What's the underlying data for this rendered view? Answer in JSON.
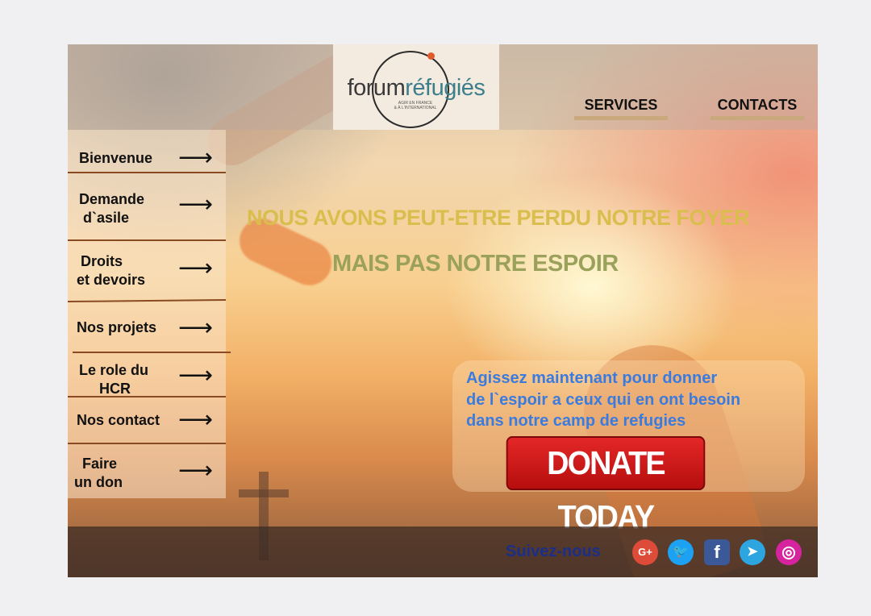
{
  "logo": {
    "part1": "forum",
    "part2": "réfugiés",
    "tagline_1": "AGIR EN FRANCE",
    "tagline_2": "& À L'INTERNATIONAL"
  },
  "nav": {
    "services": "SERVICES",
    "contacts": "CONTACTS"
  },
  "sidebar": {
    "items": [
      {
        "label": "Bienvenue",
        "arrow": "⟶"
      },
      {
        "label": "Demande\n d`asile",
        "arrow": "⟶"
      },
      {
        "label": " Droits\net devoirs",
        "arrow": "⟶"
      },
      {
        "label": "Nos projets",
        "arrow": "⟶"
      },
      {
        "label": "Le role du\n     HCR",
        "arrow": "⟶"
      },
      {
        "label": "Nos contact",
        "arrow": "⟶"
      },
      {
        "label": "  Faire\nun don",
        "arrow": "⟶"
      }
    ]
  },
  "hero": {
    "line1": "NOUS AVONS PEUT-ETRE  PERDU NOTRE FOYER",
    "line2": "MAIS PAS NOTRE ESPOIR"
  },
  "cta": {
    "text_1": "Agissez maintenant pour donner",
    "text_2": "de l`espoir a ceux qui en ont besoin",
    "text_3": "dans notre camp de refugies",
    "button": "DONATE TODAY"
  },
  "footer": {
    "follow": "Suivez-nous",
    "social": [
      {
        "name": "google-plus-icon",
        "glyph": "G+",
        "color": "#dd4b39"
      },
      {
        "name": "twitter-icon",
        "glyph": "🐦",
        "color": "#1da1f2"
      },
      {
        "name": "facebook-icon",
        "glyph": "f",
        "color": "#3b5998"
      },
      {
        "name": "telegram-icon",
        "glyph": "➤",
        "color": "#2ca5e0"
      },
      {
        "name": "instagram-icon",
        "glyph": "◎",
        "color": "#d6249f"
      }
    ]
  }
}
